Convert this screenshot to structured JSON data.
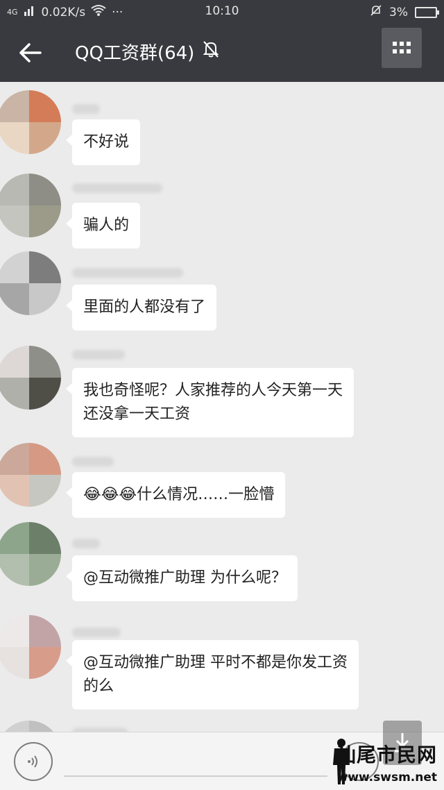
{
  "status_bar": {
    "signal": "4G",
    "speed": "0.02K/s",
    "time": "10:10",
    "battery": "3%"
  },
  "header": {
    "title": "QQ工资群(64)",
    "icons": [
      "back-arrow-icon",
      "mute-bell-icon",
      "group-menu-icon"
    ]
  },
  "messages": [
    {
      "text": "不好说"
    },
    {
      "text": "骗人的"
    },
    {
      "text": "里面的人都没有了"
    },
    {
      "text": "我也奇怪呢？人家推荐的人今天第一天\n还没拿一天工资"
    },
    {
      "emoji": "😂😂😂",
      "text": "什么情况……一脸懵"
    },
    {
      "text": "@互动微推广助理 为什么呢？"
    },
    {
      "text": "@互动微推广助理 平时不都是你发工资\n的么"
    }
  ],
  "input_bar": {
    "icons": [
      "voice-icon",
      "emoji-icon",
      "scroll-down-icon"
    ]
  },
  "watermark": {
    "text": "汕尾市民网",
    "url": "www.swsm.net"
  },
  "colors": {
    "bar": "#393a3f",
    "background": "#ebebeb",
    "bubble": "#ffffff"
  }
}
